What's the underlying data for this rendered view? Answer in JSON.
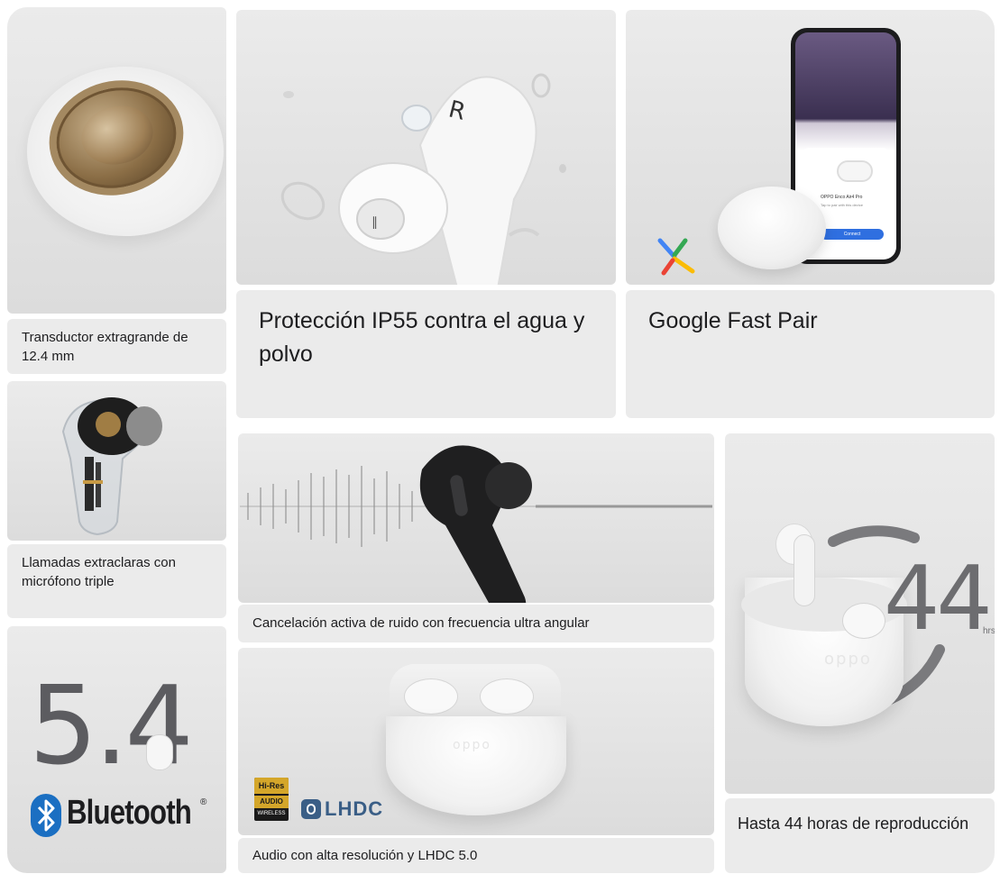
{
  "tiles": {
    "driver": {
      "caption": "Transductor extragrande de 12.4 mm"
    },
    "ip55": {
      "caption": "Protección IP55 contra el agua y polvo"
    },
    "fastpair": {
      "caption": "Google Fast Pair",
      "phone_title": "OPPO Enco Air4 Pro",
      "phone_subtitle": "Tap to pair with this device",
      "phone_button": "Connect"
    },
    "calls": {
      "caption": "Llamadas extraclaras con micrófono triple"
    },
    "anc": {
      "caption": "Cancelación activa de ruido con frecuencia ultra angular"
    },
    "battery": {
      "number": "44",
      "unit": "hrs",
      "caption": "Hasta 44 horas de reproducción",
      "case_logo": "oppo"
    },
    "bluetooth": {
      "version": "5.4",
      "brand": "Bluetooth",
      "reg": "®"
    },
    "hires": {
      "badge_top": "Hi-Res",
      "badge_mid": "AUDIO",
      "badge_bot": "WIRELESS",
      "codec": "LHDC",
      "caption": "Audio con alta resolución y LHDC 5.0",
      "case_logo": "oppo"
    }
  },
  "colors": {
    "tile_bg": "#ebebeb",
    "text": "#1d1d1f",
    "bluetooth_blue": "#1b6fc2",
    "hires_gold": "#d4a62a",
    "lhdc_blue": "#3a5e86"
  },
  "icons": [
    "google-fast-pair-icon",
    "bluetooth-icon",
    "lhdc-icon",
    "hi-res-audio-badge"
  ]
}
